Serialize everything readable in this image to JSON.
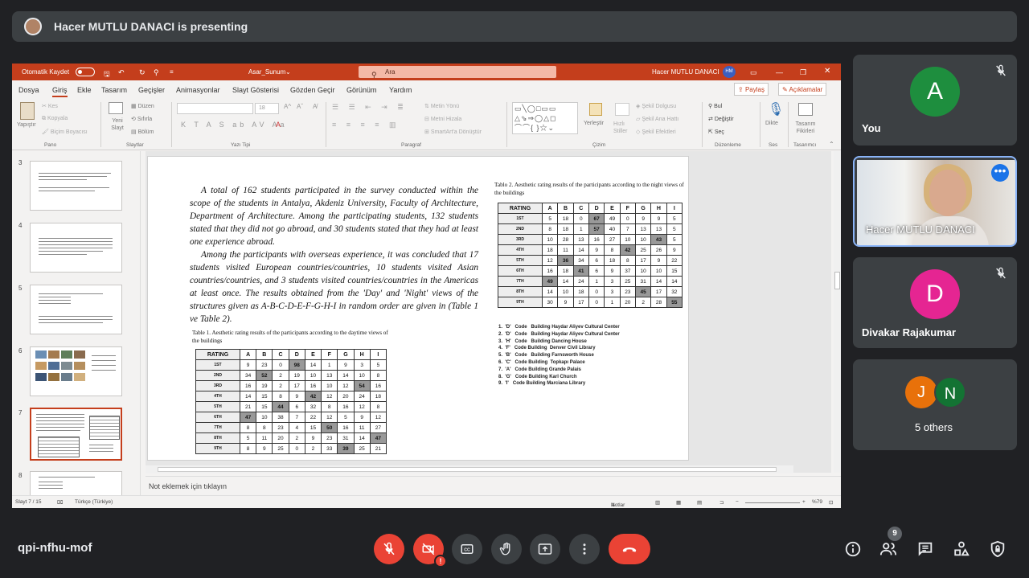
{
  "meet": {
    "presenting": "Hacer MUTLU DANACI is presenting",
    "meeting_code": "qpi-nfhu-mof",
    "participants_count": "9",
    "colors": {
      "background": "#202124",
      "tile": "#3c4043",
      "end_call": "#ea4335",
      "accent": "#1a73e8"
    }
  },
  "participants": [
    {
      "initial": "A",
      "name": "You",
      "color": "#1e8e3e",
      "muted": true
    },
    {
      "name": "Hacer MUTLU DANACI",
      "video": true
    },
    {
      "initial": "D",
      "name": "Divakar Rajakumar",
      "color": "#e52592",
      "muted": true
    },
    {
      "others_initials": [
        "J",
        "N"
      ],
      "others_colors": [
        "#e8710a",
        "#137333"
      ],
      "label": "5 others"
    }
  ],
  "ppt": {
    "autosave": "Otomatik Kaydet",
    "filename": "Asar_Sunum",
    "search_placeholder": "Ara",
    "user_name": "Hacer MUTLU DANACI",
    "user_initials": "HM",
    "menu": [
      "Dosya",
      "Giriş",
      "Ekle",
      "Tasarım",
      "Geçişler",
      "Animasyonlar",
      "Slayt Gösterisi",
      "Gözden Geçir",
      "Görünüm",
      "Yardım"
    ],
    "share": "Paylaş",
    "comments": "Açıklamalar",
    "ribbon": {
      "paste": "Yapıştır",
      "cut": "Kes",
      "copy": "Kopyala",
      "format_painter": "Biçim Boyacısı",
      "new_slide": "Yeni Slayt",
      "layout": "Düzen",
      "reset": "Sıfırla",
      "section": "Bölüm",
      "font_size": "18",
      "text_direction": "Metin Yönü",
      "align_text": "Metni Hizala",
      "smartart": "SmartArt'a Dönüştür",
      "arrange": "Yerleştir",
      "quick_styles": "Hızlı Stiller",
      "shape_fill": "Şekil Dolgusu",
      "shape_outline": "Şekil Ana Hattı",
      "shape_effects": "Şekil Efektleri",
      "find": "Bul",
      "replace": "Değiştir",
      "select": "Seç",
      "dictate": "Dikte",
      "designer": "Tasarım Fikirleri",
      "groups": {
        "clipboard": "Pano",
        "slides": "Slaytlar",
        "font": "Yazı Tipi",
        "paragraph": "Paragraf",
        "drawing": "Çizim",
        "editing": "Düzenleme",
        "voice": "Ses",
        "designer": "Tasarımcı"
      }
    },
    "thumb_numbers": [
      "3",
      "4",
      "5",
      "6",
      "7",
      "8"
    ],
    "notes_placeholder": "Not eklemek için tıklayın",
    "status": {
      "slide": "Slayt 7 / 15",
      "language": "Türkçe (Türkiye)",
      "notes": "Notlar",
      "zoom": "%79"
    }
  },
  "slide": {
    "paragraph1": "A total of 162 students participated in the survey conducted within the scope of the students in Antalya, Akdeniz University, Faculty of Architecture, Department of Architecture. Among the participating students, 132 students stated that they did not go abroad, and 30 students stated that they had at least one experience abroad.",
    "paragraph2": "Among the participants with overseas experience, it was concluded that 17 students visited European countries/countries, 10 students visited Asian countries/countries, and 3 students visited countries/countries in the Americas at least once. The results obtained from the 'Day' and 'Night' views of the structures given as A-B-C-D-E-F-G-H-I in random order are given in (Table 1 ve Table 2).",
    "table1_caption": "Table 1. Aesthetic rating results of the participants according to the daytime views of the buildings",
    "table2_caption": "Tablo 2. Aesthetic rating results of the participants according to the night views of the buildings",
    "header": [
      "RATING",
      "A",
      "B",
      "C",
      "D",
      "E",
      "F",
      "G",
      "H",
      "I"
    ],
    "rating_labels": [
      "1ST",
      "2ND",
      "3RD",
      "4TH",
      "5TH",
      "6TH",
      "7TH",
      "8TH",
      "9TH"
    ],
    "table1": [
      [
        "9",
        "23",
        "0",
        "98",
        "14",
        "1",
        "9",
        "3",
        "5"
      ],
      [
        "34",
        "52",
        "2",
        "19",
        "10",
        "13",
        "14",
        "10",
        "8"
      ],
      [
        "16",
        "19",
        "2",
        "17",
        "16",
        "10",
        "12",
        "54",
        "16"
      ],
      [
        "14",
        "15",
        "8",
        "9",
        "42",
        "12",
        "20",
        "24",
        "18"
      ],
      [
        "21",
        "15",
        "44",
        "6",
        "32",
        "8",
        "16",
        "12",
        "8"
      ],
      [
        "47",
        "10",
        "38",
        "7",
        "22",
        "12",
        "5",
        "9",
        "12"
      ],
      [
        "8",
        "8",
        "23",
        "4",
        "15",
        "50",
        "16",
        "11",
        "27"
      ],
      [
        "5",
        "11",
        "20",
        "2",
        "9",
        "23",
        "31",
        "14",
        "47"
      ],
      [
        "8",
        "9",
        "25",
        "0",
        "2",
        "33",
        "39",
        "25",
        "21"
      ]
    ],
    "table1_highlight": [
      [
        0,
        3
      ],
      [
        1,
        1
      ],
      [
        2,
        7
      ],
      [
        3,
        4
      ],
      [
        4,
        2
      ],
      [
        5,
        0
      ],
      [
        6,
        5
      ],
      [
        7,
        8
      ],
      [
        8,
        6
      ]
    ],
    "table2": [
      [
        "5",
        "18",
        "0",
        "67",
        "49",
        "0",
        "9",
        "9",
        "5"
      ],
      [
        "8",
        "18",
        "1",
        "57",
        "40",
        "7",
        "13",
        "13",
        "5"
      ],
      [
        "10",
        "28",
        "13",
        "16",
        "27",
        "10",
        "10",
        "43",
        "5"
      ],
      [
        "18",
        "11",
        "14",
        "9",
        "8",
        "42",
        "25",
        "26",
        "9"
      ],
      [
        "12",
        "36",
        "34",
        "6",
        "18",
        "8",
        "17",
        "9",
        "22"
      ],
      [
        "16",
        "18",
        "41",
        "6",
        "9",
        "37",
        "10",
        "10",
        "15"
      ],
      [
        "49",
        "14",
        "24",
        "1",
        "3",
        "25",
        "31",
        "14",
        "14"
      ],
      [
        "14",
        "10",
        "18",
        "0",
        "3",
        "23",
        "45",
        "17",
        "32"
      ],
      [
        "30",
        "9",
        "17",
        "0",
        "1",
        "20",
        "2",
        "28",
        "55"
      ]
    ],
    "table2_highlight": [
      [
        0,
        3
      ],
      [
        1,
        3
      ],
      [
        2,
        7
      ],
      [
        3,
        5
      ],
      [
        4,
        1
      ],
      [
        5,
        2
      ],
      [
        6,
        0
      ],
      [
        7,
        6
      ],
      [
        8,
        8
      ]
    ],
    "codes": [
      "1.  'D'   Code   Building Haydar Aliyev Cultural Center",
      "2.  'D'   Code   Building Haydar Aliyev Cultural Center",
      "3.  'H'   Code   Building Dancing House",
      "4.  'F'   Code Building  Denver Civil Library",
      "5.  'B'   Code   Building Farnsworth House",
      "6.  'C'   Code Building  Topkapı Palace",
      "7.  'A'   Code Building Grande Palais",
      "8.  'G'   Code Building Karl Church",
      "9.  'I'   Code Building Marciana Library"
    ]
  }
}
